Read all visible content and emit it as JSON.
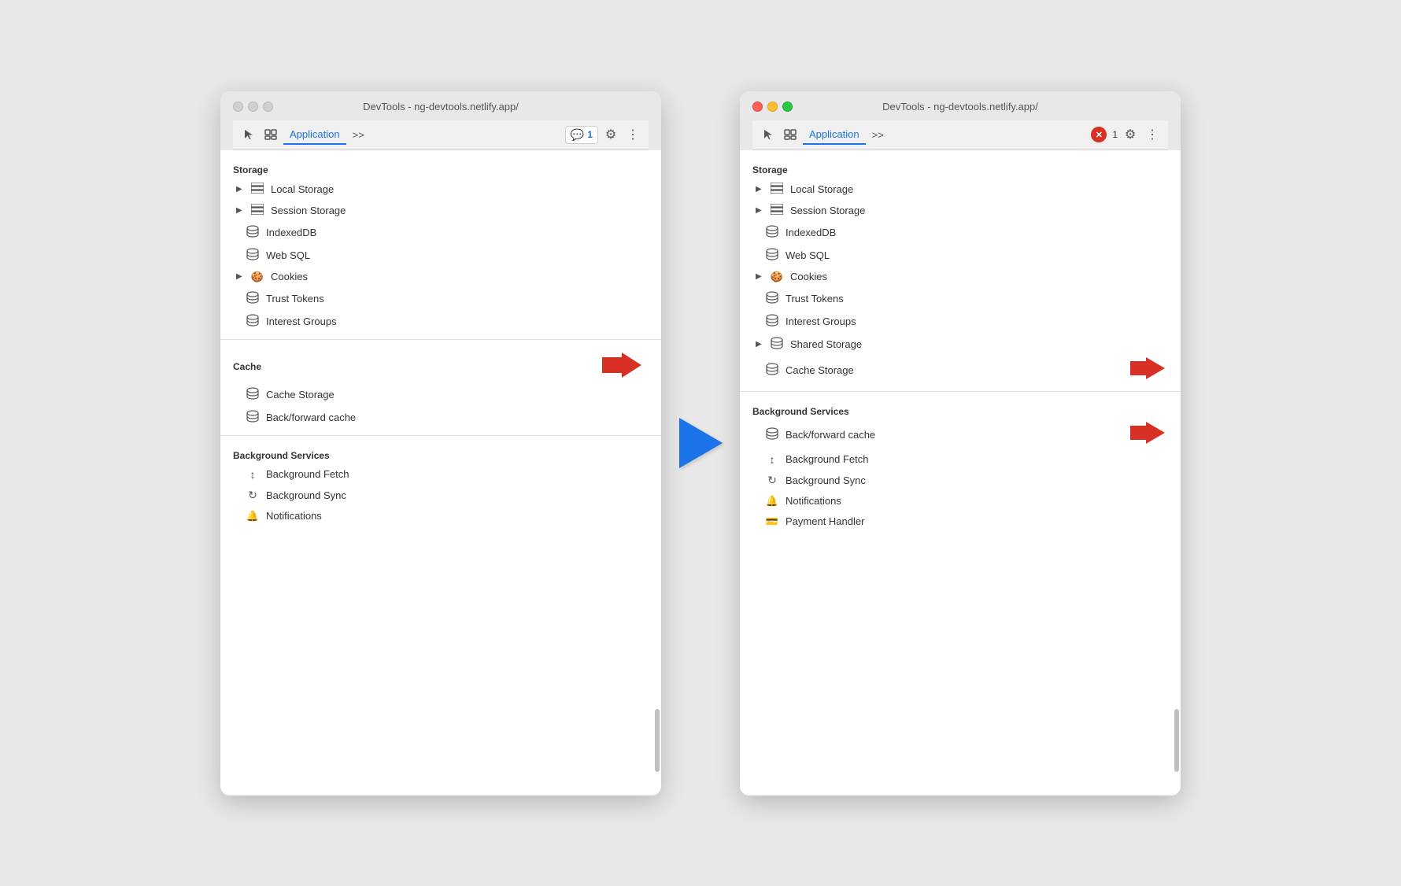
{
  "left_window": {
    "title": "DevTools - ng-devtools.netlify.app/",
    "traffic_lights": [
      "gray",
      "gray",
      "gray"
    ],
    "toolbar": {
      "tab_label": "Application",
      "more_label": ">>",
      "badge_label": "1",
      "badge_icon": "💬"
    },
    "storage_section": {
      "header": "Storage",
      "items": [
        {
          "label": "Local Storage",
          "icon": "grid",
          "expandable": true
        },
        {
          "label": "Session Storage",
          "icon": "grid",
          "expandable": true
        },
        {
          "label": "IndexedDB",
          "icon": "db",
          "expandable": false
        },
        {
          "label": "Web SQL",
          "icon": "db",
          "expandable": false
        },
        {
          "label": "Cookies",
          "icon": "cookie",
          "expandable": true
        },
        {
          "label": "Trust Tokens",
          "icon": "db",
          "expandable": false
        },
        {
          "label": "Interest Groups",
          "icon": "db",
          "expandable": false
        }
      ]
    },
    "cache_section": {
      "header": "Cache",
      "items": [
        {
          "label": "Cache Storage",
          "icon": "db",
          "expandable": false
        },
        {
          "label": "Back/forward cache",
          "icon": "db",
          "expandable": false
        }
      ],
      "has_red_arrow": true
    },
    "background_section": {
      "header": "Background Services",
      "items": [
        {
          "label": "Background Fetch",
          "icon": "updown",
          "expandable": false
        },
        {
          "label": "Background Sync",
          "icon": "sync",
          "expandable": false
        },
        {
          "label": "Notifications",
          "icon": "bell",
          "expandable": false
        }
      ]
    }
  },
  "right_window": {
    "title": "DevTools - ng-devtools.netlify.app/",
    "traffic_lights": [
      "red",
      "yellow",
      "green"
    ],
    "toolbar": {
      "tab_label": "Application",
      "more_label": ">>",
      "badge_label": "1"
    },
    "storage_section": {
      "header": "Storage",
      "items": [
        {
          "label": "Local Storage",
          "icon": "grid",
          "expandable": true
        },
        {
          "label": "Session Storage",
          "icon": "grid",
          "expandable": true
        },
        {
          "label": "IndexedDB",
          "icon": "db",
          "expandable": false
        },
        {
          "label": "Web SQL",
          "icon": "db",
          "expandable": false
        },
        {
          "label": "Cookies",
          "icon": "cookie",
          "expandable": true
        },
        {
          "label": "Trust Tokens",
          "icon": "db",
          "expandable": false
        },
        {
          "label": "Interest Groups",
          "icon": "db",
          "expandable": false
        },
        {
          "label": "Shared Storage",
          "icon": "db",
          "expandable": true,
          "has_red_arrow": false
        },
        {
          "label": "Cache Storage",
          "icon": "db",
          "expandable": false,
          "has_red_arrow": true
        }
      ]
    },
    "background_section": {
      "header": "Background Services",
      "items": [
        {
          "label": "Back/forward cache",
          "icon": "db",
          "expandable": false,
          "has_red_arrow": true
        },
        {
          "label": "Background Fetch",
          "icon": "updown",
          "expandable": false
        },
        {
          "label": "Background Sync",
          "icon": "sync",
          "expandable": false
        },
        {
          "label": "Notifications",
          "icon": "bell",
          "expandable": false
        },
        {
          "label": "Payment Handler",
          "icon": "card",
          "expandable": false
        }
      ]
    }
  },
  "icons": {
    "db": "🗄",
    "grid": "⊞",
    "cookie": "🍪",
    "updown": "↕",
    "sync": "↻",
    "bell": "🔔",
    "card": "💳",
    "gear": "⚙",
    "dots": "⋮",
    "cursor": "↖",
    "layers": "⧉",
    "chat_blue": "💬",
    "x_red": "✕"
  }
}
